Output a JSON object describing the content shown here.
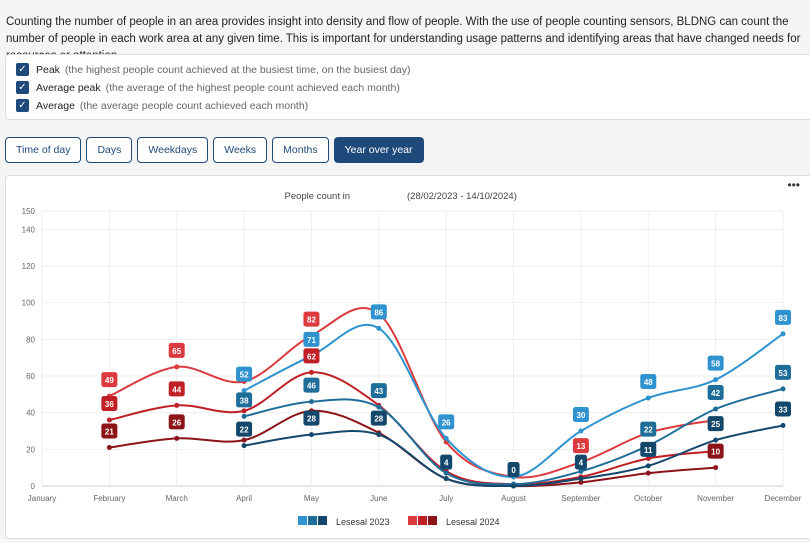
{
  "intro": "Counting the number of people in an area provides insight into density and flow of people. With the use of people counting sensors, BLDNG can count the number of people in each work area at any given time. This is important for understanding usage patterns and identifying areas that have changed needs for resources or attention.",
  "options": [
    {
      "label": "Peak",
      "desc": "(the highest people count achieved at the busiest time, on the busiest day)",
      "checked": true
    },
    {
      "label": "Average peak",
      "desc": "(the average of the highest people count achieved each month)",
      "checked": true
    },
    {
      "label": "Average",
      "desc": "(the average people count achieved each month)",
      "checked": true
    }
  ],
  "tabs": [
    {
      "label": "Time of day",
      "active": false
    },
    {
      "label": "Days",
      "active": false
    },
    {
      "label": "Weekdays",
      "active": false
    },
    {
      "label": "Weeks",
      "active": false
    },
    {
      "label": "Months",
      "active": false
    },
    {
      "label": "Year over year",
      "active": true
    }
  ],
  "menu_icon": "ellipsis-icon",
  "chart_data": {
    "type": "line",
    "title": "People count in",
    "title_range": "(28/02/2023 - 14/10/2024)",
    "categories": [
      "January",
      "February",
      "March",
      "April",
      "May",
      "June",
      "July",
      "August",
      "September",
      "October",
      "November",
      "December"
    ],
    "yticks": [
      0,
      20,
      40,
      60,
      80,
      100,
      120,
      140,
      150
    ],
    "ylim": [
      0,
      150
    ],
    "grid": true,
    "legend_position": "bottom",
    "legend": [
      {
        "name": "Lesesal 2023",
        "colors": [
          "#2e93cf",
          "#1f6e9a",
          "#13476b"
        ]
      },
      {
        "name": "Lesesal 2024",
        "colors": [
          "#db3a3e",
          "#c01f25",
          "#8c1418"
        ]
      }
    ],
    "series": [
      {
        "year": "2024",
        "metric": "Peak",
        "color": "#db3a3e",
        "values": [
          null,
          49,
          65,
          57,
          82,
          94,
          24,
          5,
          13,
          29,
          36,
          null
        ],
        "labeled": [
          1,
          2,
          4,
          8
        ]
      },
      {
        "year": "2024",
        "metric": "Average peak",
        "color": "#c01f25",
        "values": [
          null,
          36,
          44,
          41,
          62,
          44,
          8,
          1,
          5,
          15,
          19,
          null
        ],
        "labeled": [
          1,
          2,
          4
        ]
      },
      {
        "year": "2024",
        "metric": "Average",
        "color": "#8c1418",
        "values": [
          null,
          21,
          26,
          25,
          41,
          29,
          4,
          0,
          2,
          7,
          10,
          null
        ],
        "labeled": [
          1,
          2,
          10
        ]
      },
      {
        "year": "2023",
        "metric": "Peak",
        "color": "#2e93cf",
        "values": [
          null,
          null,
          null,
          52,
          71,
          86,
          26,
          5,
          30,
          48,
          58,
          83
        ],
        "labeled": [
          3,
          4,
          5,
          6,
          8,
          9,
          10,
          11
        ]
      },
      {
        "year": "2023",
        "metric": "Average peak",
        "color": "#1f6e9a",
        "values": [
          null,
          null,
          null,
          38,
          46,
          43,
          7,
          1,
          8,
          22,
          42,
          53
        ],
        "labeled": [
          3,
          4,
          5,
          9,
          10,
          11
        ]
      },
      {
        "year": "2023",
        "metric": "Average",
        "color": "#13476b",
        "values": [
          null,
          null,
          null,
          22,
          28,
          28,
          4,
          0,
          4,
          11,
          25,
          33
        ],
        "labeled": [
          3,
          4,
          5,
          6,
          7,
          8,
          9,
          10,
          11
        ]
      }
    ]
  }
}
